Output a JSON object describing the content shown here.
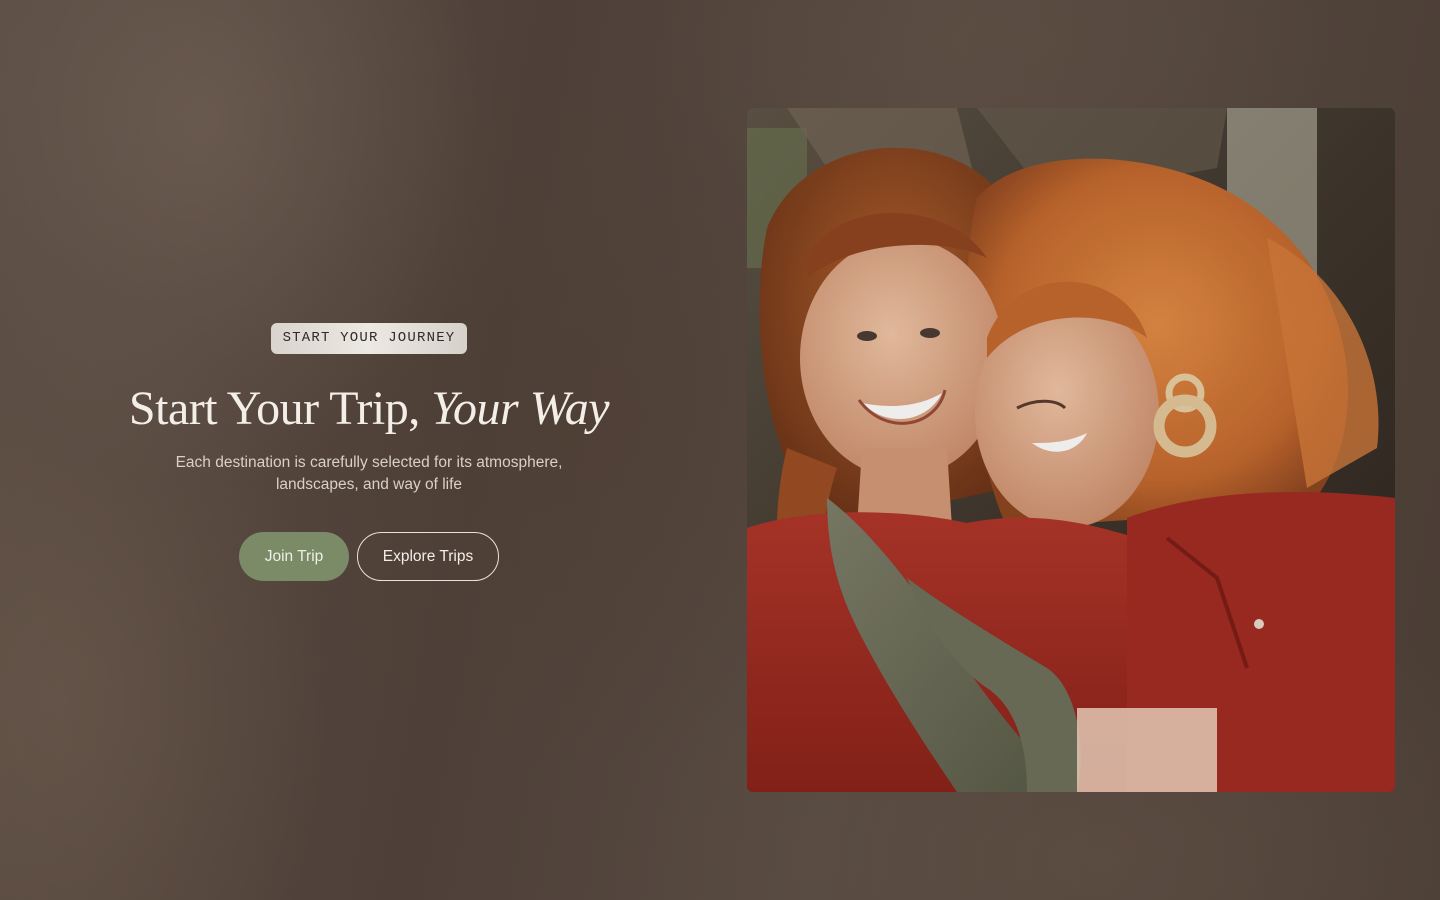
{
  "hero": {
    "eyebrow": "START YOUR JOURNEY",
    "title_plain": "Start Your Trip, ",
    "title_italic": "Your Way",
    "subtitle": "Each destination is carefully selected for its atmosphere, landscapes, and way of life",
    "primary_button": "Join Trip",
    "secondary_button": "Explore Trips"
  },
  "photo": {
    "subject": "two-women-smiling-photo"
  },
  "colors": {
    "background": "#4f4239",
    "primary_button": "#7b8a67",
    "title_text": "#f3eee8",
    "eyebrow_bg": "#e4dfd8"
  }
}
